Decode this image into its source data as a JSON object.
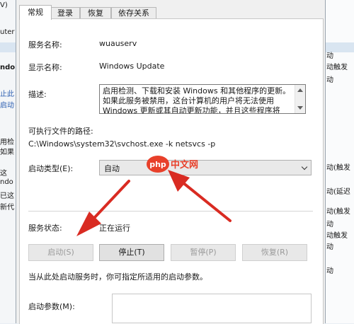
{
  "background": {
    "left_column": [
      "V)",
      "uter",
      "ndo",
      "止此",
      "启动",
      "",
      "用检",
      "如果",
      "这",
      "ndo",
      "已这",
      "新代"
    ],
    "right_column": [
      "动",
      "动触发",
      "动",
      "",
      "",
      "",
      "",
      "动(触发",
      "",
      "动(延迟",
      "动(触发",
      "动",
      "动触发",
      "动",
      "动"
    ]
  },
  "tabs": [
    "常规",
    "登录",
    "恢复",
    "依存关系"
  ],
  "service_name": {
    "label": "服务名称:",
    "value": "wuauserv"
  },
  "display_name": {
    "label": "显示名称:",
    "value": "Windows Update"
  },
  "description": {
    "label": "描述:",
    "text": "启用检测、下载和安装 Windows 和其他程序的更新。如果此服务被禁用，这台计算机的用户将无法使用 Windows 更新或其自动更新功能，并且这些程序将"
  },
  "executable": {
    "label": "可执行文件的路径:",
    "path": "C:\\Windows\\system32\\svchost.exe -k netsvcs -p"
  },
  "startup_type": {
    "label": "启动类型(E):",
    "value": "自动"
  },
  "service_status": {
    "label": "服务状态:",
    "value": "正在运行"
  },
  "buttons": {
    "start": "启动(S)",
    "stop": "停止(T)",
    "pause": "暂停(P)",
    "resume": "恢复(R)"
  },
  "hint": "当从此处启动服务时，你可指定所适用的启动参数。",
  "start_params": {
    "label": "启动参数(M):"
  },
  "watermark": {
    "php": "php",
    "site": "中文网"
  },
  "colors": {
    "arrow": "#d92b22",
    "watermark_badge": "#e8402a"
  }
}
